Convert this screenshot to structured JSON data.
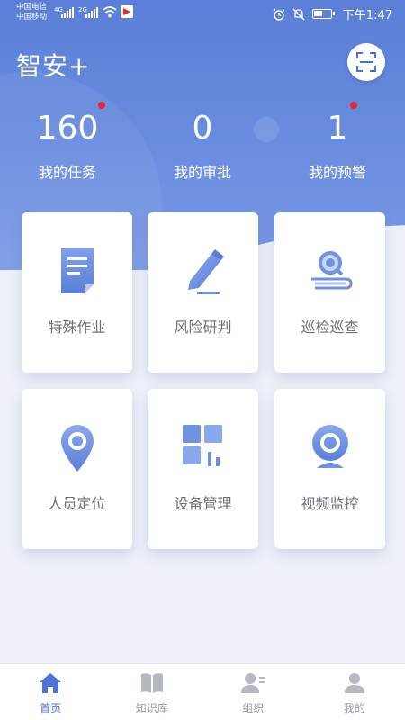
{
  "status_bar": {
    "carrier_1": "中国电信",
    "carrier_2": "中国移动",
    "net_1": "4G",
    "net_2": "2G",
    "time": "下午1:47"
  },
  "header": {
    "title": "智安+"
  },
  "stats": [
    {
      "value": "160",
      "label": "我的任务",
      "has_alert": true
    },
    {
      "value": "0",
      "label": "我的审批",
      "has_alert": false
    },
    {
      "value": "1",
      "label": "我的预警",
      "has_alert": true
    }
  ],
  "modules": [
    {
      "label": "特殊作业",
      "icon": "document-icon"
    },
    {
      "label": "风险研判",
      "icon": "pencil-icon"
    },
    {
      "label": "巡检巡查",
      "icon": "inspection-search-icon"
    },
    {
      "label": "人员定位",
      "icon": "location-pin-icon"
    },
    {
      "label": "设备管理",
      "icon": "dashboard-grid-icon"
    },
    {
      "label": "视频监控",
      "icon": "webcam-icon"
    }
  ],
  "bottom_nav": [
    {
      "label": "首页",
      "icon": "home-icon",
      "active": true
    },
    {
      "label": "知识库",
      "icon": "book-icon",
      "active": false
    },
    {
      "label": "组织",
      "icon": "organization-icon",
      "active": false
    },
    {
      "label": "我的",
      "icon": "user-icon",
      "active": false
    }
  ],
  "colors": {
    "primary": "#5b7fd8",
    "icon_blue": "#6f92e2",
    "alert_red": "#e8262b",
    "nav_active": "#4b73d6",
    "nav_inactive": "#9a9ea8"
  }
}
